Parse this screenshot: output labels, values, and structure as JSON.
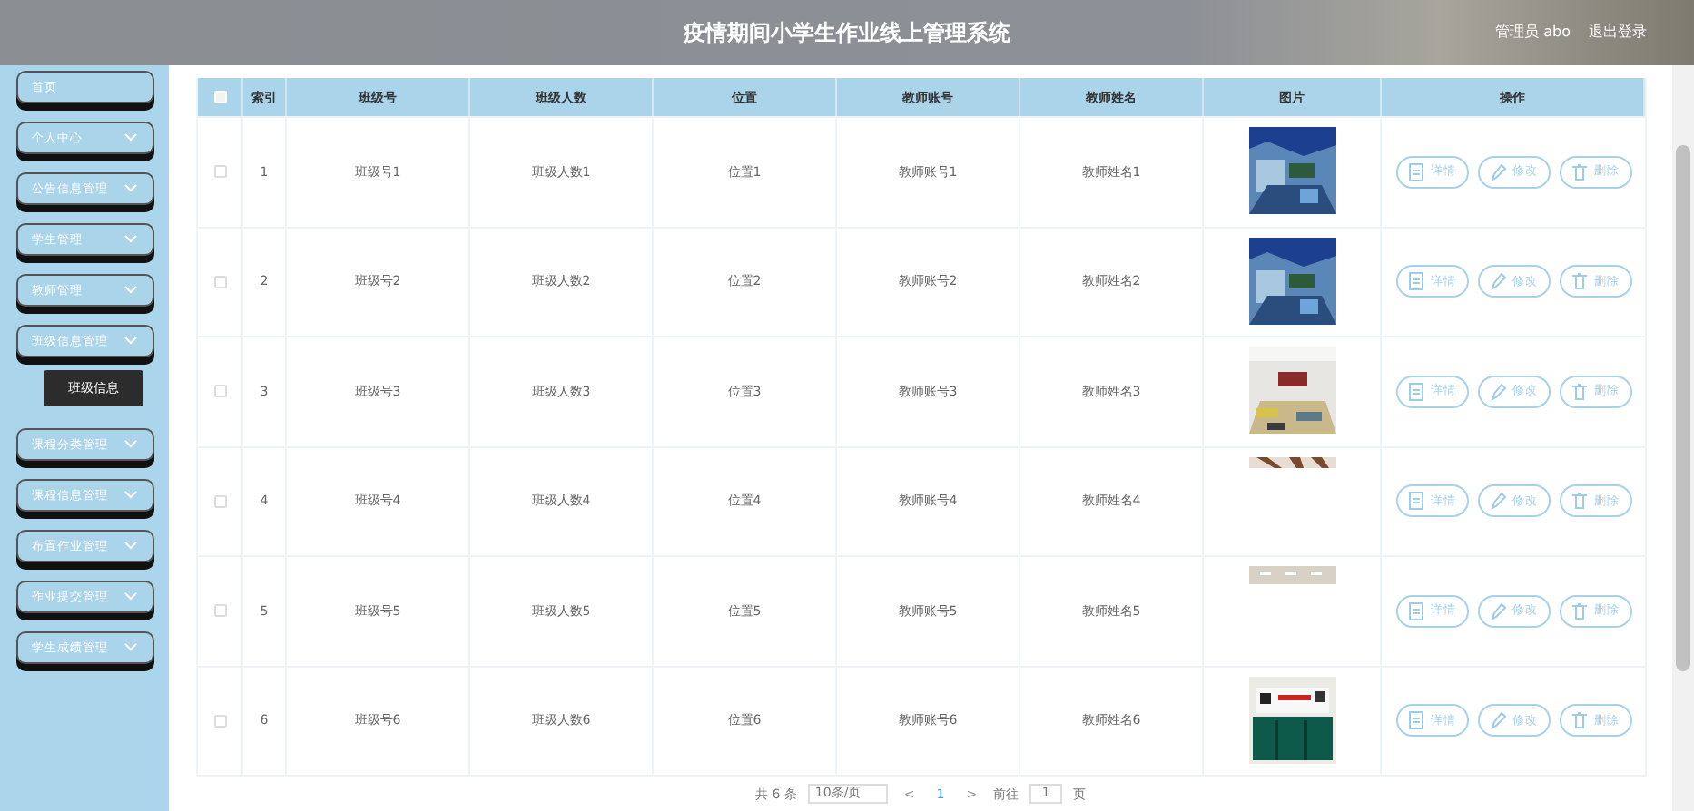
{
  "header": {
    "title": "疫情期间小学生作业线上管理系统",
    "user": "管理员 abo",
    "logout": "退出登录"
  },
  "sidebar": {
    "items": [
      {
        "label": "首页",
        "has_children": false
      },
      {
        "label": "个人中心",
        "has_children": true,
        "expanded": false
      },
      {
        "label": "公告信息管理",
        "has_children": true,
        "expanded": false
      },
      {
        "label": "学生管理",
        "has_children": true,
        "expanded": false
      },
      {
        "label": "教师管理",
        "has_children": true,
        "expanded": false
      },
      {
        "label": "班级信息管理",
        "has_children": true,
        "expanded": true,
        "children": [
          {
            "label": "班级信息",
            "selected": true
          }
        ]
      },
      {
        "label": "课程分类管理",
        "has_children": true,
        "expanded": false
      },
      {
        "label": "课程信息管理",
        "has_children": true,
        "expanded": false
      },
      {
        "label": "布置作业管理",
        "has_children": true,
        "expanded": false
      },
      {
        "label": "作业提交管理",
        "has_children": true,
        "expanded": false
      },
      {
        "label": "学生成绩管理",
        "has_children": true,
        "expanded": false
      }
    ]
  },
  "table": {
    "all_checked": false,
    "columns": [
      "索引",
      "班级号",
      "班级人数",
      "位置",
      "教师账号",
      "教师姓名",
      "图片",
      "操作"
    ],
    "rows": [
      {
        "checked": false,
        "cells": [
          "1",
          "班级号1",
          "班级人数1",
          "位置1",
          "教师账号1",
          "教师姓名1"
        ],
        "actions": [
          "详情",
          "修改",
          "删除"
        ]
      },
      {
        "checked": false,
        "cells": [
          "2",
          "班级号2",
          "班级人数2",
          "位置2",
          "教师账号2",
          "教师姓名2"
        ],
        "actions": [
          "详情",
          "修改",
          "删除"
        ]
      },
      {
        "checked": false,
        "cells": [
          "3",
          "班级号3",
          "班级人数3",
          "位置3",
          "教师账号3",
          "教师姓名3"
        ],
        "actions": [
          "详情",
          "修改",
          "删除"
        ]
      },
      {
        "checked": false,
        "cells": [
          "4",
          "班级号4",
          "班级人数4",
          "位置4",
          "教师账号4",
          "教师姓名4"
        ],
        "actions": [
          "详情",
          "修改",
          "删除"
        ]
      },
      {
        "checked": false,
        "cells": [
          "5",
          "班级号5",
          "班级人数5",
          "位置5",
          "教师账号5",
          "教师姓名5"
        ],
        "actions": [
          "详情",
          "修改",
          "删除"
        ]
      },
      {
        "checked": false,
        "cells": [
          "6",
          "班级号6",
          "班级人数6",
          "位置6",
          "教师账号6",
          "教师姓名6"
        ],
        "actions": [
          "详情",
          "修改",
          "删除"
        ]
      }
    ]
  },
  "pagination": {
    "total": "共 6 条",
    "page_size": "10条/页",
    "prev": "<",
    "page": "1",
    "next": ">",
    "goto_label": "前往",
    "goto_value": "1",
    "goto_unit": "页"
  }
}
